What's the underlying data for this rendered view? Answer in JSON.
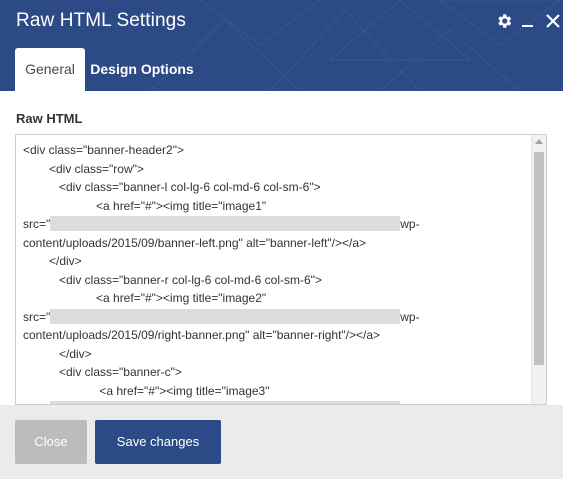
{
  "window": {
    "title": "Raw HTML Settings",
    "controls": [
      "gear-icon",
      "minimize-icon",
      "close-icon"
    ]
  },
  "tabs": [
    {
      "label": "General",
      "active": true
    },
    {
      "label": "Design Options",
      "active": false
    }
  ],
  "field": {
    "label": "Raw HTML"
  },
  "code_lines": [
    {
      "indent": 0,
      "text": "<div class=\"banner-header2\">"
    },
    {
      "indent": 1,
      "text": "<div class=\"row\">"
    },
    {
      "indent": 2,
      "text": "<div class=\"banner-l col-lg-6 col-md-6 col-sm-6\">"
    },
    {
      "indent": 3,
      "text": "<a href=\"#\"><img title=\"image1\""
    },
    {
      "indent": 0,
      "text": "src=\"",
      "redacted": true,
      "after": "wp-"
    },
    {
      "indent": 0,
      "text": "content/uploads/2015/09/banner-left.png\" alt=\"banner-left\"/></a>"
    },
    {
      "indent": 1,
      "text": "</div>"
    },
    {
      "indent": 2,
      "text": "<div class=\"banner-r col-lg-6 col-md-6 col-sm-6\">"
    },
    {
      "indent": 3,
      "text": "<a href=\"#\"><img title=\"image2\""
    },
    {
      "indent": 0,
      "text": "src=\"",
      "redacted": true,
      "after": "wp-"
    },
    {
      "indent": 0,
      "text": "content/uploads/2015/09/right-banner.png\" alt=\"banner-right\"/></a>"
    },
    {
      "indent": 2,
      "text": "</div>"
    },
    {
      "indent": 2,
      "text": "<div class=\"banner-c\">"
    },
    {
      "indent": 3,
      "text": " <a href=\"#\"><img title=\"image3\""
    },
    {
      "indent": 0,
      "text": "src=\"",
      "redacted": true,
      "after": "wp-"
    }
  ],
  "buttons": {
    "close_label": "Close",
    "save_label": "Save changes"
  },
  "colors": {
    "header": "#2c4a86",
    "primary_button": "#2c4a86",
    "disabled_button": "#bcbcbc",
    "footer": "#ebebeb"
  }
}
